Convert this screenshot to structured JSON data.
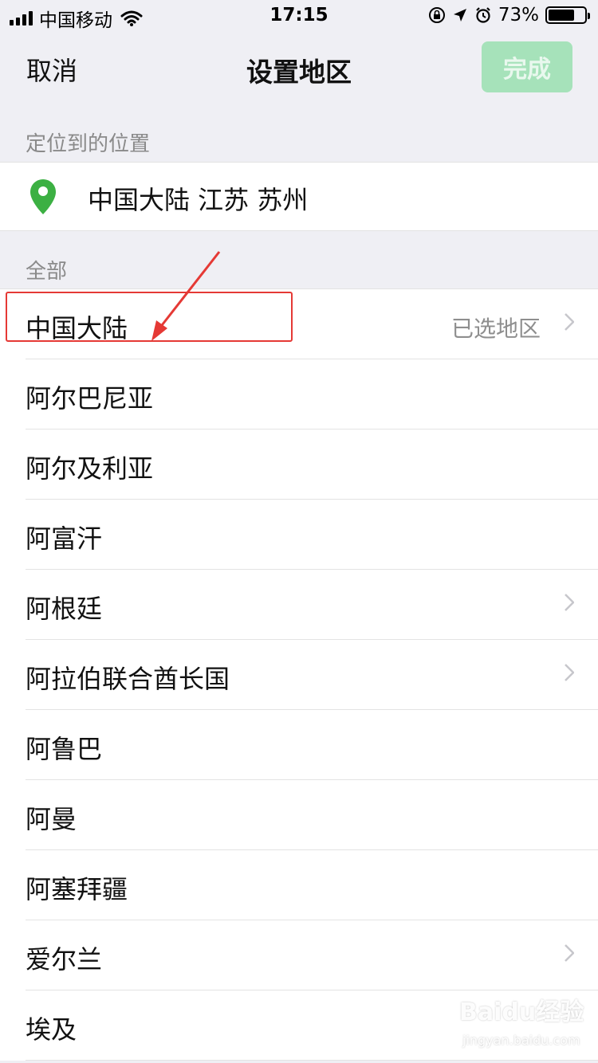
{
  "status_bar": {
    "carrier": "中国移动",
    "time": "17:15",
    "battery": "73%",
    "battery_level": 0.73,
    "icons": [
      "signal-icon",
      "wifi-icon",
      "orientation-lock-icon",
      "location-arrow-icon",
      "alarm-icon",
      "battery-icon"
    ]
  },
  "nav": {
    "cancel": "取消",
    "title": "设置地区",
    "done": "完成"
  },
  "located": {
    "header": "定位到的位置",
    "location": "中国大陆 江苏 苏州",
    "pin_color": "#3cb043"
  },
  "all": {
    "header": "全部",
    "regions": [
      {
        "label": "中国大陆",
        "sub": "已选地区",
        "chevron": true
      },
      {
        "label": "阿尔巴尼亚",
        "sub": "",
        "chevron": false
      },
      {
        "label": "阿尔及利亚",
        "sub": "",
        "chevron": false
      },
      {
        "label": "阿富汗",
        "sub": "",
        "chevron": false
      },
      {
        "label": "阿根廷",
        "sub": "",
        "chevron": true
      },
      {
        "label": "阿拉伯联合酋长国",
        "sub": "",
        "chevron": true
      },
      {
        "label": "阿鲁巴",
        "sub": "",
        "chevron": false
      },
      {
        "label": "阿曼",
        "sub": "",
        "chevron": false
      },
      {
        "label": "阿塞拜疆",
        "sub": "",
        "chevron": false
      },
      {
        "label": "爱尔兰",
        "sub": "",
        "chevron": true
      },
      {
        "label": "埃及",
        "sub": "",
        "chevron": false
      }
    ]
  },
  "colors": {
    "done_bg": "#a6e2ba",
    "annotation": "#e53935"
  },
  "watermark": {
    "brand": "Baidu经验",
    "url": "jingyan.baidu.com"
  }
}
